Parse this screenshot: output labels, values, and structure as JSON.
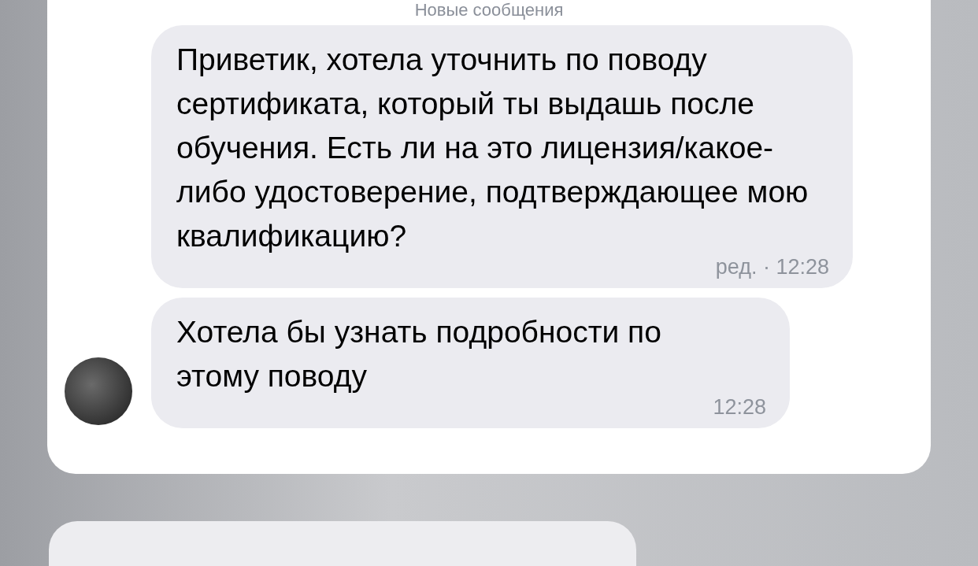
{
  "divider": "Новые сообщения",
  "messages": [
    {
      "text": "Приветик, хотела уточнить по поводу сертификата, который ты выдашь после обучения. Есть ли на это лицензия/какое-либо удостоверение, подтверждающее мою квалификацию?",
      "meta": "ред. · 12:28",
      "avatar": false
    },
    {
      "text": "Хотела бы узнать подробности по этому поводу",
      "meta": "12:28",
      "avatar": true
    }
  ]
}
